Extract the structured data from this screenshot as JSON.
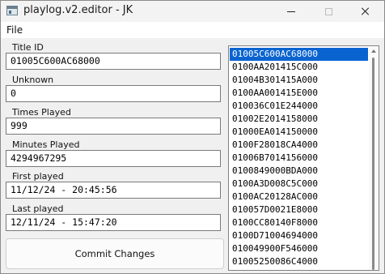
{
  "window": {
    "title": "playlog.v2.editor - JK"
  },
  "menu": {
    "file": "File"
  },
  "fields": {
    "title_id": {
      "label": "Title ID",
      "value": "01005C600AC68000"
    },
    "unknown": {
      "label": "Unknown",
      "value": "0"
    },
    "times_played": {
      "label": "Times Played",
      "value": "999"
    },
    "minutes_played": {
      "label": "Minutes Played",
      "value": "4294967295"
    },
    "first_played": {
      "label": "First played",
      "value": "11/12/24 - 20:45:56"
    },
    "last_played": {
      "label": "Last played",
      "value": "12/11/24 - 15:47:20"
    }
  },
  "commit_label": "Commit Changes",
  "title_list": {
    "selected_index": 0,
    "items": [
      "01005C600AC68000",
      "0100AA201415C000",
      "01004B301415A000",
      "0100AA001415E000",
      "010036C01E244000",
      "01002E2014158000",
      "01000EA014150000",
      "0100F28018CA4000",
      "01006B7014156000",
      "0100849000BDA000",
      "0100A3D008C5C000",
      "0100AC20128AC000",
      "010057D0021E8000",
      "0100CC80140F8000",
      "0100D71004694000",
      "010049900F546000",
      "01005250086C4000"
    ]
  },
  "colors": {
    "selection": "#0a64d0",
    "background": "#f0f0f0"
  }
}
